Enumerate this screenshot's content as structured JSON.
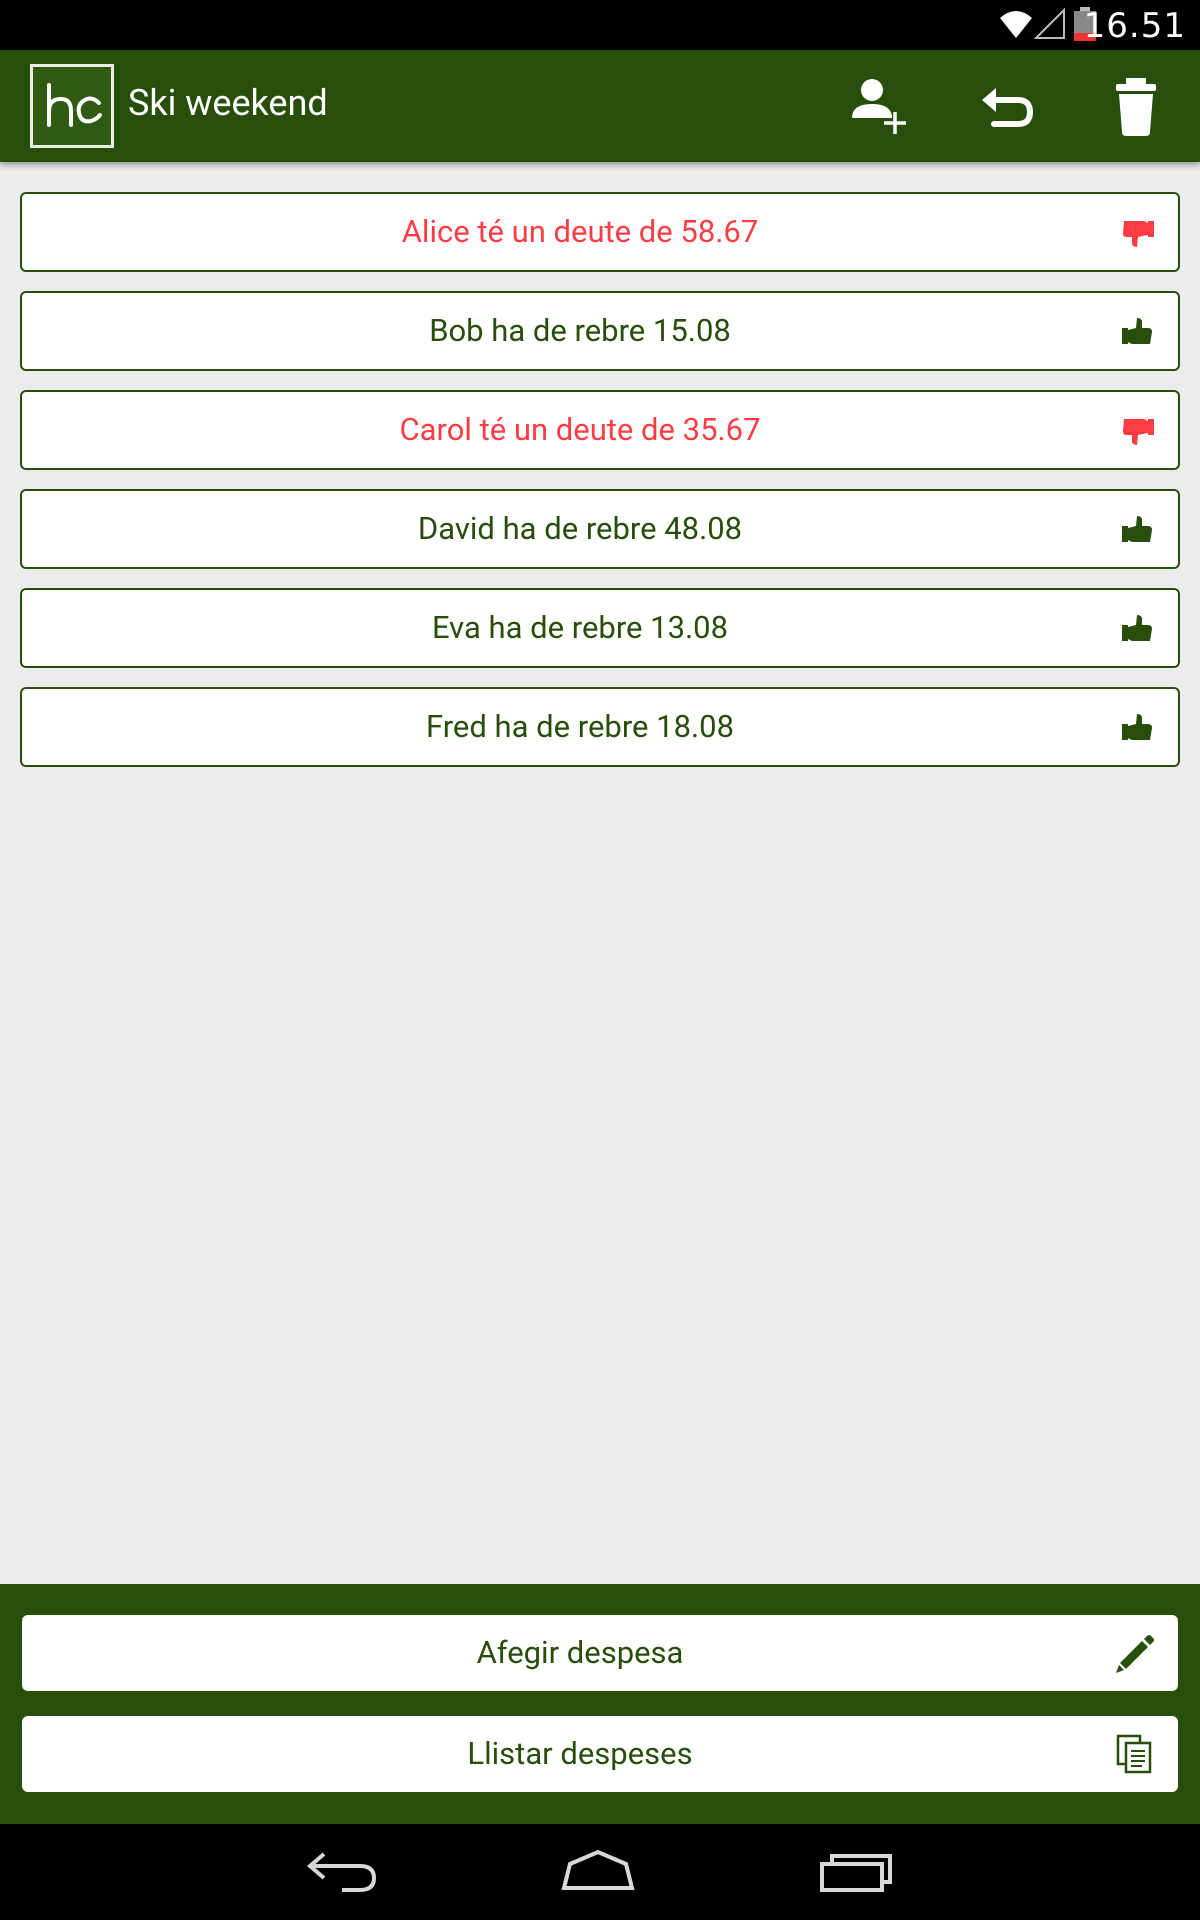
{
  "status_bar": {
    "time": "16.51",
    "icons": [
      "wifi-icon",
      "cell-signal-icon",
      "battery-icon"
    ]
  },
  "action_bar": {
    "logo_text": "hc",
    "title": "Ski weekend",
    "actions": [
      "add-person-icon",
      "undo-icon",
      "trash-icon"
    ],
    "background_color": "#284e0b"
  },
  "balances": [
    {
      "text": "Alice té un deute de 58.67",
      "status": "debt",
      "icon": "thumbs-down-icon"
    },
    {
      "text": "Bob ha de rebre 15.08",
      "status": "credit",
      "icon": "thumbs-up-icon"
    },
    {
      "text": "Carol té un deute de 35.67",
      "status": "debt",
      "icon": "thumbs-down-icon"
    },
    {
      "text": "David ha de rebre 48.08",
      "status": "credit",
      "icon": "thumbs-up-icon"
    },
    {
      "text": "Eva ha de rebre 13.08",
      "status": "credit",
      "icon": "thumbs-up-icon"
    },
    {
      "text": "Fred ha de rebre 18.08",
      "status": "credit",
      "icon": "thumbs-up-icon"
    }
  ],
  "colors": {
    "debt": "#ff3c43",
    "credit": "#284e0b"
  },
  "bottom_panel": {
    "add_expense_label": "Afegir despesa",
    "add_expense_icon": "pencil-icon",
    "list_expenses_label": "Llistar despeses",
    "list_expenses_icon": "document-list-icon"
  },
  "nav_bar": {
    "buttons": [
      "back-icon",
      "home-icon",
      "recent-apps-icon"
    ]
  }
}
